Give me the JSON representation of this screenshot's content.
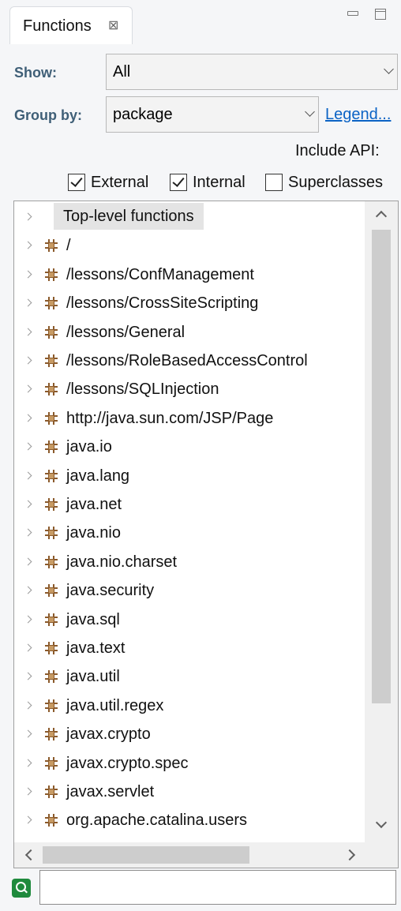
{
  "view": {
    "tab_title": "Functions",
    "tab_close_glyph": "⊠",
    "minimize_icon": "minimize-icon",
    "maximize_icon": "maximize-icon"
  },
  "controls": {
    "show_label": "Show:",
    "show_value": "All",
    "group_by_label": "Group by:",
    "group_by_value": "package",
    "legend_link": "Legend...",
    "include_api_label": "Include API:",
    "checkboxes": [
      {
        "label": "External",
        "checked": true
      },
      {
        "label": "Internal",
        "checked": true
      },
      {
        "label": "Superclasses",
        "checked": false
      }
    ]
  },
  "tree": {
    "items": [
      {
        "label": "Top-level functions",
        "icon": "none"
      },
      {
        "label": "/",
        "icon": "package-icon"
      },
      {
        "label": "/lessons/ConfManagement",
        "icon": "package-icon"
      },
      {
        "label": "/lessons/CrossSiteScripting",
        "icon": "package-icon"
      },
      {
        "label": "/lessons/General",
        "icon": "package-icon"
      },
      {
        "label": "/lessons/RoleBasedAccessControl",
        "icon": "package-icon"
      },
      {
        "label": "/lessons/SQLInjection",
        "icon": "package-icon"
      },
      {
        "label": "http://java.sun.com/JSP/Page",
        "icon": "package-icon"
      },
      {
        "label": "java.io",
        "icon": "package-icon"
      },
      {
        "label": "java.lang",
        "icon": "package-icon"
      },
      {
        "label": "java.net",
        "icon": "package-icon"
      },
      {
        "label": "java.nio",
        "icon": "package-icon"
      },
      {
        "label": "java.nio.charset",
        "icon": "package-icon"
      },
      {
        "label": "java.security",
        "icon": "package-icon"
      },
      {
        "label": "java.sql",
        "icon": "package-icon"
      },
      {
        "label": "java.text",
        "icon": "package-icon"
      },
      {
        "label": "java.util",
        "icon": "package-icon"
      },
      {
        "label": "java.util.regex",
        "icon": "package-icon"
      },
      {
        "label": "javax.crypto",
        "icon": "package-icon"
      },
      {
        "label": "javax.crypto.spec",
        "icon": "package-icon"
      },
      {
        "label": "javax.servlet",
        "icon": "package-icon"
      },
      {
        "label": "org.apache.catalina.users",
        "icon": "package-icon"
      }
    ]
  },
  "filter": {
    "icon": "search-icon",
    "value": ""
  },
  "colors": {
    "label_blue": "#3f5f77",
    "link_blue": "#0b63c5",
    "package_icon": "#8b5a2b",
    "filter_icon": "#1f8a3d"
  }
}
